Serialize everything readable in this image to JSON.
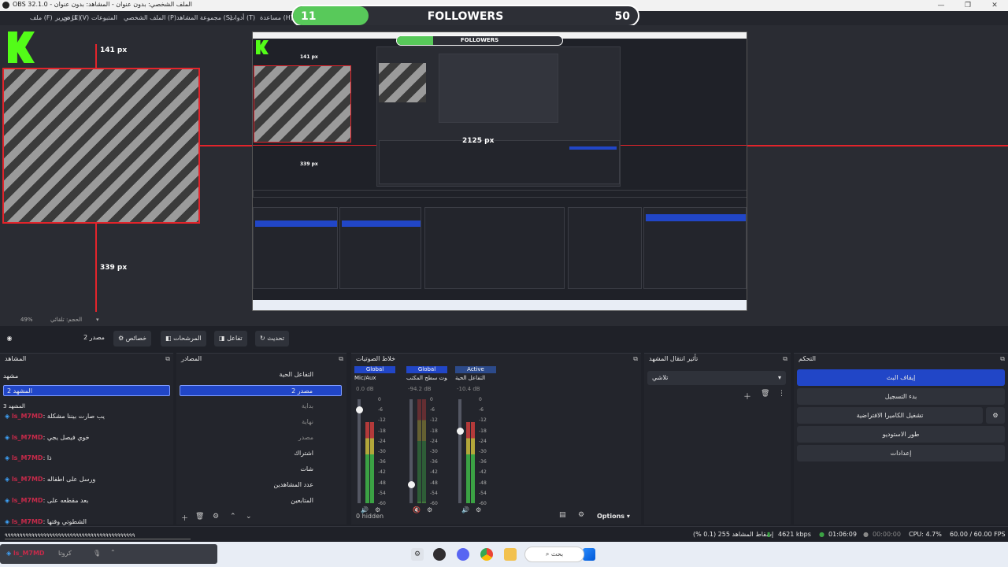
{
  "window": {
    "title": "OBS 32.1.0 - الملف الشخصي: بدون عنوان - المشاهد: بدون عنوان",
    "minimize": "—",
    "maximize": "❐",
    "close": "✕"
  },
  "menu": [
    "ملف (F)",
    "تحرير (E)",
    "عرض (V)",
    "المتبوعات",
    "الملف الشخصي (P)",
    "مجموعة المشاهد (S)",
    "أدوات (T)",
    "مساعدة (H)"
  ],
  "follower_goal": {
    "current": "11",
    "label": "FOLLOWERS",
    "goal": "50",
    "progress_fraction": 0.22,
    "bar_color": "#58c95a"
  },
  "preview": {
    "dim_top": "141 px",
    "dim_bottom": "339 px",
    "nested_dim": "2125 px",
    "nested_dim_small1": "141 px",
    "nested_dim_small2": "339 px",
    "nested_follow": "FOLLOWERS",
    "nested_follow_cur": "11",
    "nested_follow_goal": "50",
    "zoom": "49%",
    "zoom_label": "الحجم: تلقائي",
    "accent": "#e3242b"
  },
  "toolbar": {
    "scene_name": "مصدر 2",
    "properties": "خصائص",
    "filters": "المرشحات",
    "interact": "تفاعل",
    "refresh": "تحديث"
  },
  "scenes": {
    "title": "المشاهد",
    "items": [
      "مشهد",
      "المشهد 2",
      "المشهد 3"
    ],
    "selected_index": 1
  },
  "chat": {
    "messages": [
      {
        "user": "ls_M7MD",
        "text": ": يب صارت بيننا مشكلة"
      },
      {
        "user": "ls_M7MD",
        "text": ": خوي فيصل يجي"
      },
      {
        "user": "ls_M7MD",
        "text": ": ذا"
      },
      {
        "user": "ls_M7MD",
        "text": ": ورسل على اطفاله"
      },
      {
        "user": "ls_M7MD",
        "text": ": بعد مقطعه على"
      },
      {
        "user": "ls_M7MD",
        "text": ": الشطوتي وقتها"
      }
    ],
    "input": "٩٩٩٩٩٩٩٩٩٩٩٩٩٩٩٩٩٩٩٩٩٩٩٩٩٩٩٩٩٩٩٩٩٩٩٩٩٩٩٩٩٩٩٩",
    "footer_user": "ls_M7MD",
    "footer_label": "كروتا"
  },
  "sources": {
    "title": "المصادر",
    "items": [
      {
        "name": "التفاعل الحية",
        "selected": false
      },
      {
        "name": "مصدر 2",
        "selected": true
      },
      {
        "name": "بداية",
        "selected": false
      },
      {
        "name": "نهاية",
        "selected": false
      },
      {
        "name": "مصدر",
        "selected": false
      },
      {
        "name": "اشتراك",
        "selected": false
      },
      {
        "name": "شات",
        "selected": false
      },
      {
        "name": "عدد المشاهدين",
        "selected": false
      },
      {
        "name": "المتابعين",
        "selected": false
      }
    ]
  },
  "mixer": {
    "title": "خلاط الصوتيات",
    "channels": [
      {
        "tag": "Global",
        "name": "Mic/Aux",
        "db": "0.0 dB",
        "level": 0.78,
        "fader": 0.9,
        "active": false,
        "muted": false
      },
      {
        "tag": "Global",
        "name": "صوت سطح المكتب",
        "db": "-94.2 dB",
        "level": 0.0,
        "fader": 0.18,
        "active": false,
        "muted": true
      },
      {
        "tag": "Active",
        "name": "التفاعل الحية",
        "db": "-10.4 dB",
        "level": 0.78,
        "fader": 0.7,
        "active": true,
        "muted": false
      }
    ],
    "ticks": [
      "0",
      "-6",
      "-12",
      "-18",
      "-24",
      "-30",
      "-36",
      "-42",
      "-48",
      "-54",
      "-60"
    ],
    "hidden": "0 hidden",
    "options": "Options"
  },
  "transitions": {
    "title": "تأثير انتقال المشهد",
    "selected": "تلاشي"
  },
  "controls": {
    "title": "التحكم",
    "buttons": [
      "إيقاف البث",
      "بدء التسجيل",
      "تشغيل الكاميرا الافتراضية",
      "طور الاستوديو",
      "إعدادات"
    ]
  },
  "status": {
    "dropped": "إسقاط المشاهد 255 (0.1 %)",
    "bitrate": "4621 kbps",
    "live_time": "01:06:09",
    "rec_time": "00:00:00",
    "cpu": "CPU: 4.7%",
    "fps": "60.00 / 60.00 FPS"
  },
  "taskbar": {
    "search": "بحث",
    "apps": [
      "settings-app",
      "obs-app",
      "discord-app",
      "chrome-app",
      "files-app"
    ]
  }
}
